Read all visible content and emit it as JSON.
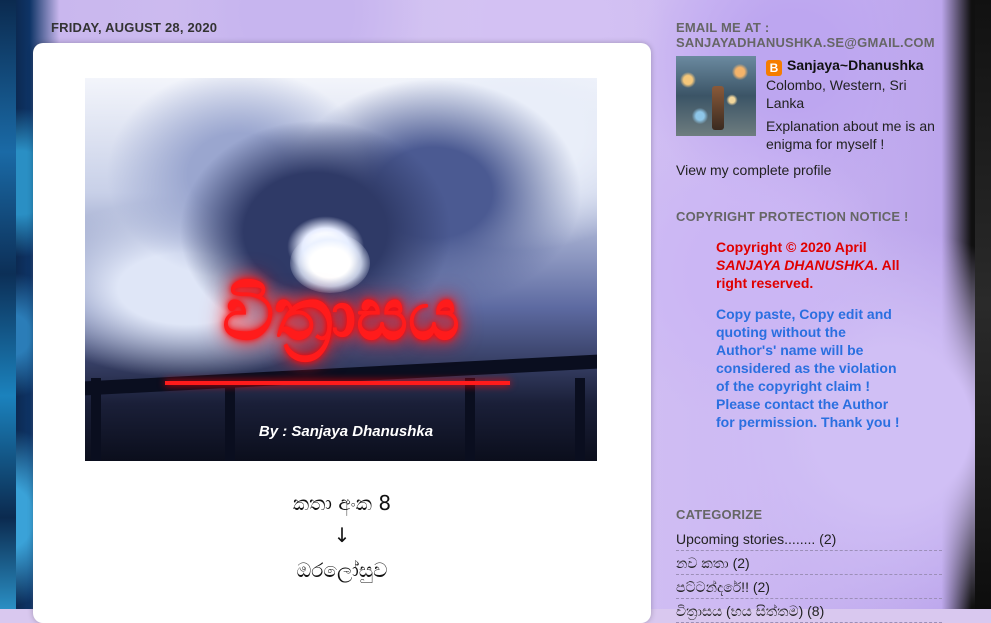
{
  "post": {
    "date": "FRIDAY, AUGUST 28, 2020",
    "image_title": "විත්‍රාසය",
    "image_byline": "By : Sanjaya Dhanushka",
    "story_number": "කතා අංක 8",
    "arrow": "↓",
    "story_title": "ඔරලෝසුව"
  },
  "sidebar": {
    "email_title": "EMAIL ME AT :",
    "email_address": "SANJAYADHANUSHKA.SE@GMAIL.COM",
    "profile": {
      "blogger_icon": "B",
      "name": "Sanjaya~Dhanushka",
      "location": "Colombo, Western, Sri Lanka",
      "about": "Explanation about me is an enigma for myself !",
      "view_profile": "View my complete profile"
    },
    "copyright": {
      "title": "COPYRIGHT PROTECTION NOTICE !",
      "line1": "Copyright © 2020 April",
      "author": "SANJAYA DHANUSHKA.",
      "line2": " All right reserved.",
      "notice": "Copy paste, Copy edit and quoting without the Author's' name will be considered as the violation of the copyright claim ! Please contact the Author for permission.  Thank you !"
    },
    "categories": {
      "title": "CATEGORIZE",
      "items": [
        {
          "label": "Upcoming stories........",
          "count": "(2)"
        },
        {
          "label": "නව කතා",
          "count": "(2)"
        },
        {
          "label": "පට්ටන්දරේ!!",
          "count": "(2)"
        },
        {
          "label": "විත්‍රාසය (භය සිත්තම)",
          "count": "(8)"
        }
      ]
    }
  },
  "colors": {
    "copyright_red": "#e00000",
    "notice_blue": "#2a6fe0",
    "blogger_orange": "#f57d00",
    "title_glow_red": "#ff1b1b"
  }
}
